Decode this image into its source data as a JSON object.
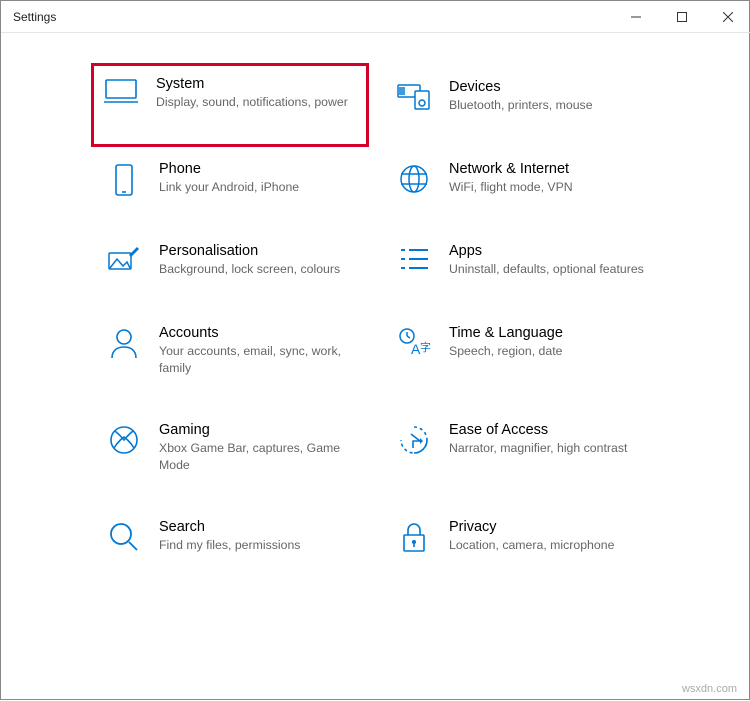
{
  "window": {
    "title": "Settings"
  },
  "tiles": {
    "system": {
      "title": "System",
      "desc": "Display, sound, notifications, power"
    },
    "devices": {
      "title": "Devices",
      "desc": "Bluetooth, printers, mouse"
    },
    "phone": {
      "title": "Phone",
      "desc": "Link your Android, iPhone"
    },
    "network": {
      "title": "Network & Internet",
      "desc": "WiFi, flight mode, VPN"
    },
    "personalisation": {
      "title": "Personalisation",
      "desc": "Background, lock screen, colours"
    },
    "apps": {
      "title": "Apps",
      "desc": "Uninstall, defaults, optional features"
    },
    "accounts": {
      "title": "Accounts",
      "desc": "Your accounts, email, sync, work, family"
    },
    "time": {
      "title": "Time & Language",
      "desc": "Speech, region, date"
    },
    "gaming": {
      "title": "Gaming",
      "desc": "Xbox Game Bar, captures, Game Mode"
    },
    "ease": {
      "title": "Ease of Access",
      "desc": "Narrator, magnifier, high contrast"
    },
    "search": {
      "title": "Search",
      "desc": "Find my files, permissions"
    },
    "privacy": {
      "title": "Privacy",
      "desc": "Location, camera, microphone"
    }
  },
  "highlight_color": "#d4002a",
  "icon_color": "#0078d4",
  "watermark": "wsxdn.com"
}
